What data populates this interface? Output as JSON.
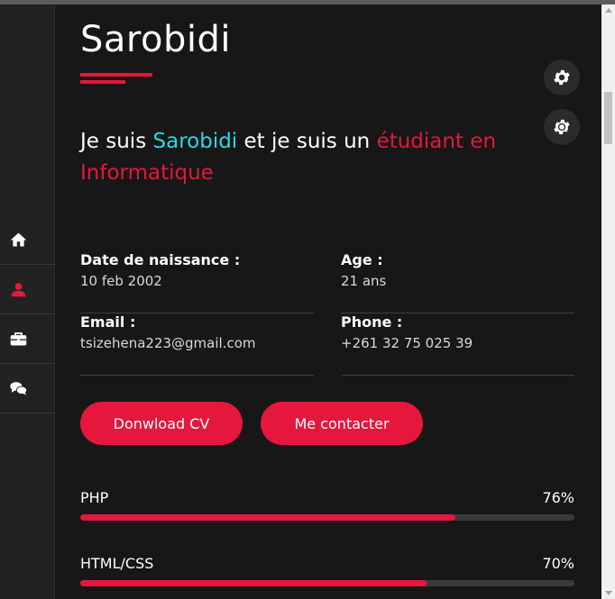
{
  "sidebar": {
    "items": [
      {
        "icon": "home-icon",
        "active": false
      },
      {
        "icon": "user-icon",
        "active": true
      },
      {
        "icon": "briefcase-icon",
        "active": false
      },
      {
        "icon": "chat-icon",
        "active": false
      }
    ]
  },
  "main": {
    "title": "Sarobidi",
    "intro": {
      "part1": "Je suis ",
      "name": "Sarobidi",
      "part2": " et je suis un ",
      "role": "étudiant en Informatique"
    },
    "info": [
      {
        "label": "Date de naissance :",
        "value": "10 feb 2002"
      },
      {
        "label": "Age :",
        "value": "21 ans"
      },
      {
        "label": "Email :",
        "value": "tsizehena223@gmail.com"
      },
      {
        "label": "Phone :",
        "value": "+261 32 75 025 39"
      }
    ],
    "buttons": {
      "download_cv": "Donwload CV",
      "contact": "Me contacter"
    },
    "skills": [
      {
        "name": "PHP",
        "percent_label": "76%",
        "percent": 76
      },
      {
        "name": "HTML/CSS",
        "percent_label": "70%",
        "percent": 70
      }
    ]
  },
  "theme": {
    "accent": "#e5173d",
    "highlight": "#2fd7e0",
    "background": "#171717"
  },
  "settings": {
    "icons": [
      "gear-icon",
      "sun-icon"
    ]
  }
}
